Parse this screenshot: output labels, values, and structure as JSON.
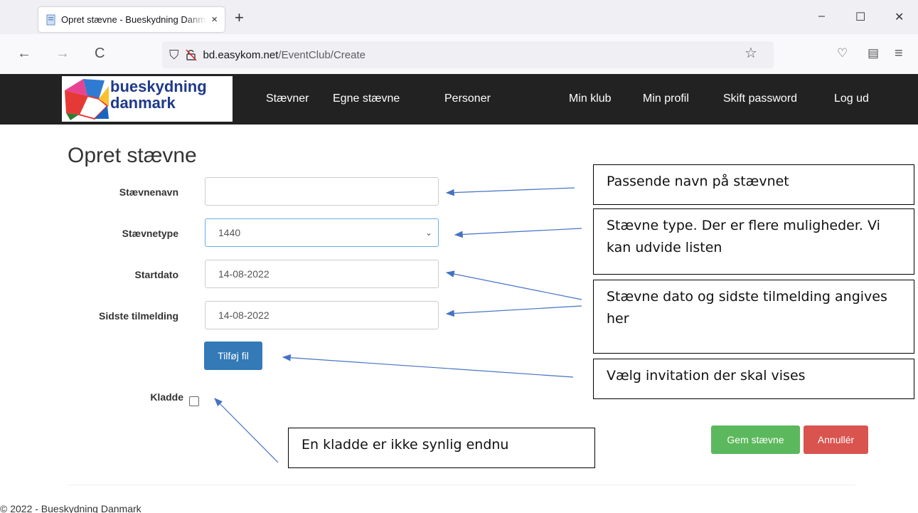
{
  "browser": {
    "tab_title": "Opret stævne - Bueskydning Danmark",
    "tab_close": "×",
    "newtab": "+",
    "url_domain": "bd.easykom.net",
    "url_path": "/EventClub/Create",
    "win_min": "–",
    "win_max": "☐",
    "win_close": "✕",
    "back": "←",
    "forward": "→",
    "reload": "C",
    "star": "☆",
    "pocket": "♡",
    "reader": "▤",
    "menu": "≡"
  },
  "site": {
    "logo_line1": "bueskydning",
    "logo_line2": "danmark",
    "nav": [
      "Stævner",
      "Egne stævne",
      "Personer",
      "Min klub",
      "Min profil",
      "Skift password",
      "Log ud"
    ]
  },
  "form": {
    "title": "Opret stævne",
    "name_label": "Stævnenavn",
    "name_value": "",
    "type_label": "Stævnetype",
    "type_value": "1440",
    "start_label": "Startdato",
    "start_value": "14-08-2022",
    "deadline_label": "Sidste tilmelding",
    "deadline_value": "14-08-2022",
    "file_button": "Tilføj fil",
    "draft_label": "Kladde",
    "draft_checked": false,
    "save_button": "Gem stævne",
    "cancel_button": "Annullér"
  },
  "footer": "© 2022 - Bueskydning Danmark",
  "callouts": {
    "name": "Passende navn på stævnet",
    "type": "Stævne type. Der er flere muligheder. Vi kan udvide listen",
    "dates": "Stævne dato og sidste tilmelding angives her",
    "file": "Vælg invitation der skal vises",
    "draft": "En kladde er ikke synlig endnu"
  },
  "colors": {
    "primary": "#337ab7",
    "success": "#5cb85c",
    "danger": "#d9534f",
    "navbar": "#222222",
    "arrow": "#4472c4"
  }
}
